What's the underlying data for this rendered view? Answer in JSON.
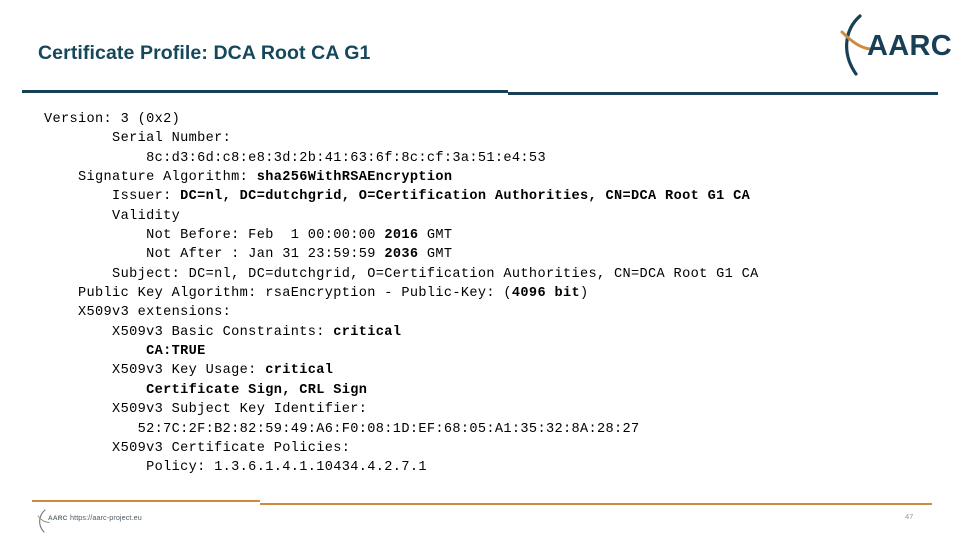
{
  "slide": {
    "title": "Certificate Profile: DCA Root CA G1",
    "title_color": "#16485c",
    "header_rule_color": "#173f55",
    "footer_rule_color": "#d08a3e",
    "background_color": "#ffffff"
  },
  "logo": {
    "name": "aarc-logo",
    "wordmark": "AARC",
    "arc_dark_color": "#173f55",
    "arc_orange_color": "#d08a3e"
  },
  "certificate": {
    "lines": [
      {
        "indent": 0,
        "segments": [
          {
            "text": "Version: 3 (0x2)",
            "bold": false
          }
        ]
      },
      {
        "indent": 0,
        "segments": [
          {
            "text": "        Serial Number:",
            "bold": false
          }
        ]
      },
      {
        "indent": 0,
        "segments": [
          {
            "text": "            8c:d3:6d:c8:e8:3d:2b:41:63:6f:8c:cf:3a:51:e4:53",
            "bold": false
          }
        ]
      },
      {
        "indent": 0,
        "segments": [
          {
            "text": "    Signature Algorithm: ",
            "bold": false
          },
          {
            "text": "sha256WithRSAEncryption",
            "bold": true
          }
        ]
      },
      {
        "indent": 0,
        "segments": [
          {
            "text": "        Issuer: ",
            "bold": false
          },
          {
            "text": "DC=nl, DC=dutchgrid, O=Certification Authorities, CN=DCA Root G1 CA",
            "bold": true
          }
        ]
      },
      {
        "indent": 0,
        "segments": [
          {
            "text": "        Validity",
            "bold": false
          }
        ]
      },
      {
        "indent": 0,
        "segments": [
          {
            "text": "            Not Before: Feb  1 00:00:00 ",
            "bold": false
          },
          {
            "text": "2016",
            "bold": true
          },
          {
            "text": " GMT",
            "bold": false
          }
        ]
      },
      {
        "indent": 0,
        "segments": [
          {
            "text": "            Not After : Jan 31 23:59:59 ",
            "bold": false
          },
          {
            "text": "2036",
            "bold": true
          },
          {
            "text": " GMT",
            "bold": false
          }
        ]
      },
      {
        "indent": 0,
        "segments": [
          {
            "text": "        Subject: DC=nl, DC=dutchgrid, O=Certification Authorities, CN=DCA Root G1 CA",
            "bold": false
          }
        ]
      },
      {
        "indent": 0,
        "segments": [
          {
            "text": "    Public Key Algorithm: rsaEncryption - Public-Key: (",
            "bold": false
          },
          {
            "text": "4096 bit",
            "bold": true
          },
          {
            "text": ")",
            "bold": false
          }
        ]
      },
      {
        "indent": 0,
        "segments": [
          {
            "text": "    X509v3 extensions:",
            "bold": false
          }
        ]
      },
      {
        "indent": 0,
        "segments": [
          {
            "text": "        X509v3 Basic Constraints: ",
            "bold": false
          },
          {
            "text": "critical",
            "bold": true
          }
        ]
      },
      {
        "indent": 0,
        "segments": [
          {
            "text": "            ",
            "bold": false
          },
          {
            "text": "CA:TRUE",
            "bold": true
          }
        ]
      },
      {
        "indent": 0,
        "segments": [
          {
            "text": "        X509v3 Key Usage: ",
            "bold": false
          },
          {
            "text": "critical",
            "bold": true
          }
        ]
      },
      {
        "indent": 0,
        "segments": [
          {
            "text": "            ",
            "bold": false
          },
          {
            "text": "Certificate Sign, CRL Sign",
            "bold": true
          }
        ]
      },
      {
        "indent": 0,
        "segments": [
          {
            "text": "        X509v3 Subject Key Identifier:",
            "bold": false
          }
        ]
      },
      {
        "indent": 0,
        "segments": [
          {
            "text": "           52:7C:2F:B2:82:59:49:A6:F0:08:1D:EF:68:05:A1:35:32:8A:28:27",
            "bold": false
          }
        ]
      },
      {
        "indent": 0,
        "segments": [
          {
            "text": "        X509v3 Certificate Policies:",
            "bold": false
          }
        ]
      },
      {
        "indent": 0,
        "segments": [
          {
            "text": "            Policy: 1.3.6.1.4.1.10434.4.2.7.1",
            "bold": false
          }
        ]
      }
    ]
  },
  "footer": {
    "logo_wordmark": "AARC",
    "url": "https://aarc-project.eu",
    "page_number": "47"
  }
}
